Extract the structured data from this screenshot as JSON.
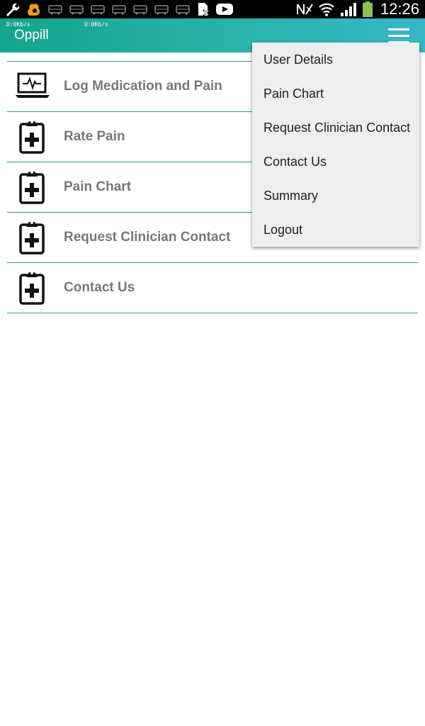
{
  "status_bar": {
    "left_icons": [
      "wrench-icon",
      "squirrel-icon",
      "bus-icon",
      "bus-icon",
      "bus-icon",
      "bus-icon",
      "bus-icon",
      "bus-icon",
      "bus-icon",
      "sim-error-icon",
      "youtube-icon"
    ],
    "right_icons": [
      "no-notification-icon",
      "wifi-icon",
      "signal-icon",
      "battery-icon"
    ],
    "time": "12:26"
  },
  "app_bar": {
    "download_speed": "D:0Kb/s",
    "upload_speed": "U:0Kb/s",
    "title": "Oppill",
    "menu_icon": "hamburger-icon",
    "gradient": [
      "#14a48d",
      "#35b7c9"
    ]
  },
  "menu_list": [
    {
      "label": "Log Medication and Pain",
      "icon": "laptop-pulse-icon"
    },
    {
      "label": "Rate Pain",
      "icon": "clipboard-plus-icon"
    },
    {
      "label": "Pain Chart",
      "icon": "clipboard-plus-icon"
    },
    {
      "label": "Request Clinician Contact",
      "icon": "clipboard-plus-icon"
    },
    {
      "label": "Contact Us",
      "icon": "clipboard-plus-icon"
    }
  ],
  "overflow_menu": [
    "User Details",
    "Pain Chart",
    "Request Clinician Contact",
    "Contact Us",
    "Summary",
    "Logout"
  ],
  "colors": {
    "divider": "#2c9b8e",
    "label": "#777777",
    "popup_bg": "#eeeeee",
    "battery": "#8bc34a"
  }
}
